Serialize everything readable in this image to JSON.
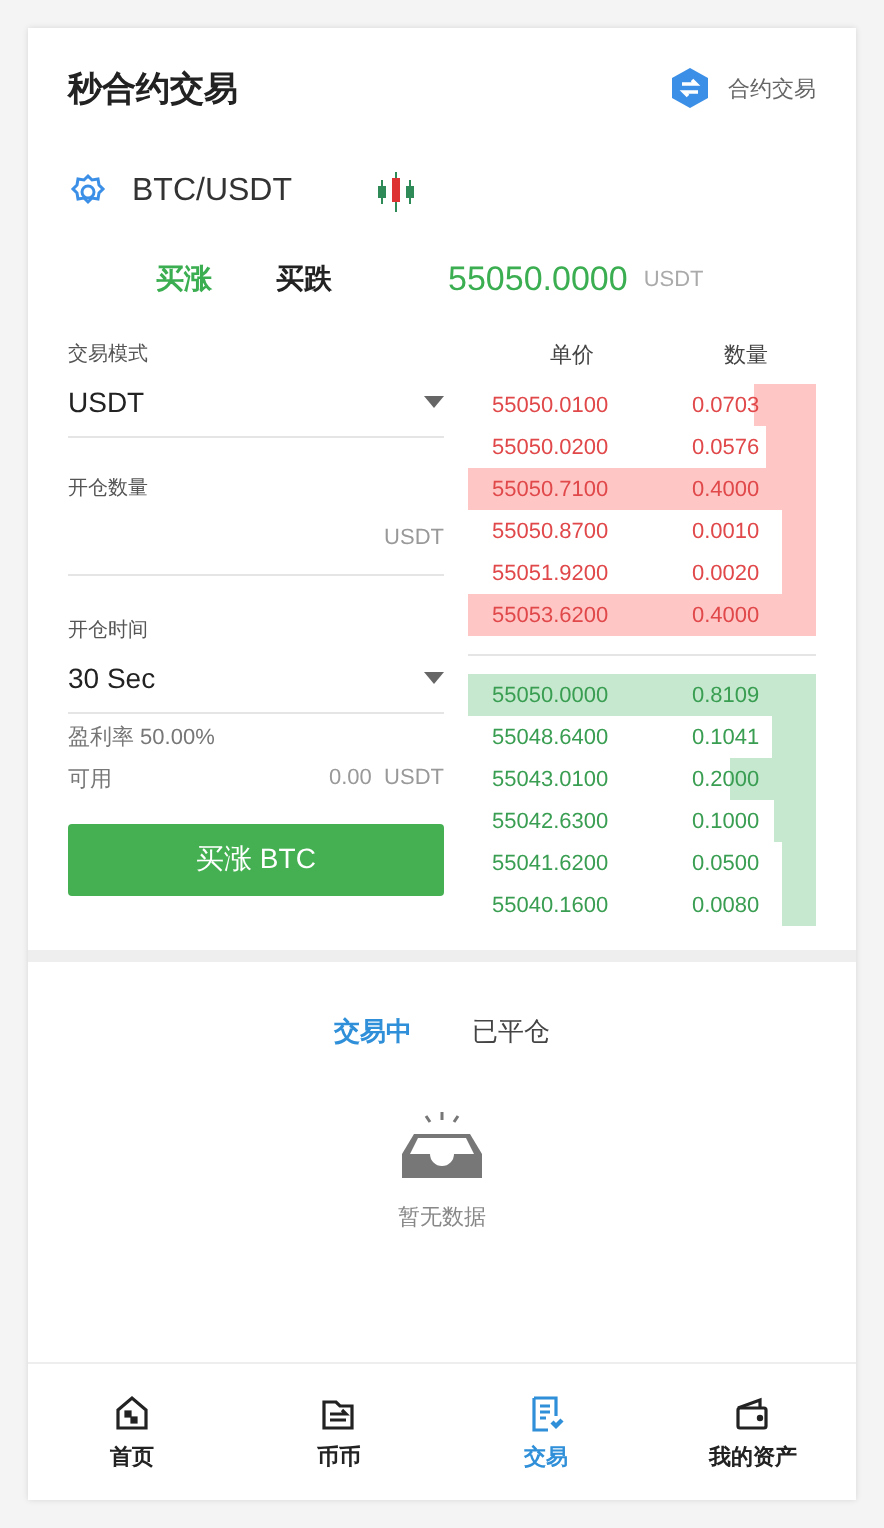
{
  "header": {
    "title": "秒合约交易",
    "link": "合约交易"
  },
  "pair": {
    "symbol": "BTC/USDT"
  },
  "direction_tabs": [
    {
      "label": "买涨",
      "selected": true
    },
    {
      "label": "买跌",
      "selected": false
    }
  ],
  "last_price": {
    "value": "55050.0000",
    "unit": "USDT"
  },
  "form": {
    "mode_label": "交易模式",
    "mode_value": "USDT",
    "amount_label": "开仓数量",
    "amount_unit": "USDT",
    "time_label": "开仓时间",
    "time_value": "30 Sec",
    "profit_rate": "盈利率 50.00%",
    "available_label": "可用",
    "available_value": "0.00",
    "available_unit": "USDT",
    "submit": "买涨 BTC"
  },
  "order_book": {
    "columns": [
      "单价",
      "数量"
    ],
    "asks": [
      {
        "price": "55050.0100",
        "amount": "0.0703"
      },
      {
        "price": "55050.0200",
        "amount": "0.0576"
      },
      {
        "price": "55050.7100",
        "amount": "0.4000"
      },
      {
        "price": "55050.8700",
        "amount": "0.0010"
      },
      {
        "price": "55051.9200",
        "amount": "0.0020"
      },
      {
        "price": "55053.6200",
        "amount": "0.4000"
      }
    ],
    "bids": [
      {
        "price": "55050.0000",
        "amount": "0.8109"
      },
      {
        "price": "55048.6400",
        "amount": "0.1041"
      },
      {
        "price": "55043.0100",
        "amount": "0.2000"
      },
      {
        "price": "55042.6300",
        "amount": "0.1000"
      },
      {
        "price": "55041.6200",
        "amount": "0.0500"
      },
      {
        "price": "55040.1600",
        "amount": "0.0080"
      }
    ]
  },
  "order_tabs": [
    {
      "label": "交易中",
      "selected": true
    },
    {
      "label": "已平仓",
      "selected": false
    }
  ],
  "empty_text": "暂无数据",
  "bottom_nav": [
    {
      "label": "首页",
      "kind": "home",
      "selected": false
    },
    {
      "label": "币币",
      "kind": "exchange",
      "selected": false
    },
    {
      "label": "交易",
      "kind": "trade",
      "selected": true
    },
    {
      "label": "我的资产",
      "kind": "wallet",
      "selected": false
    }
  ]
}
